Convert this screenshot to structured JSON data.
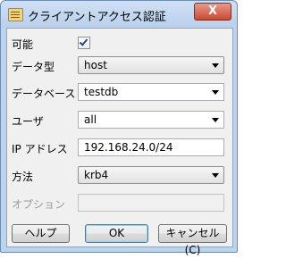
{
  "window": {
    "title": "クライアントアクセス認証",
    "close_label": "X"
  },
  "form": {
    "enabled": {
      "label": "可能",
      "checked": true
    },
    "data_type": {
      "label": "データ型",
      "value": "host"
    },
    "database": {
      "label": "データベース",
      "value": "testdb"
    },
    "user": {
      "label": "ユーザ",
      "value": "all"
    },
    "ip_address": {
      "label": "IP アドレス",
      "value": "192.168.24.0/24"
    },
    "method": {
      "label": "方法",
      "value": "krb4"
    },
    "option": {
      "label": "オプション",
      "value": ""
    }
  },
  "buttons": {
    "help": "ヘルプ",
    "ok": "OK",
    "cancel": "キャンセル(C)"
  },
  "icons": {
    "app": "app-icon",
    "close": "close-icon",
    "check": "check-icon",
    "dropdown": "chevron-down-icon"
  }
}
